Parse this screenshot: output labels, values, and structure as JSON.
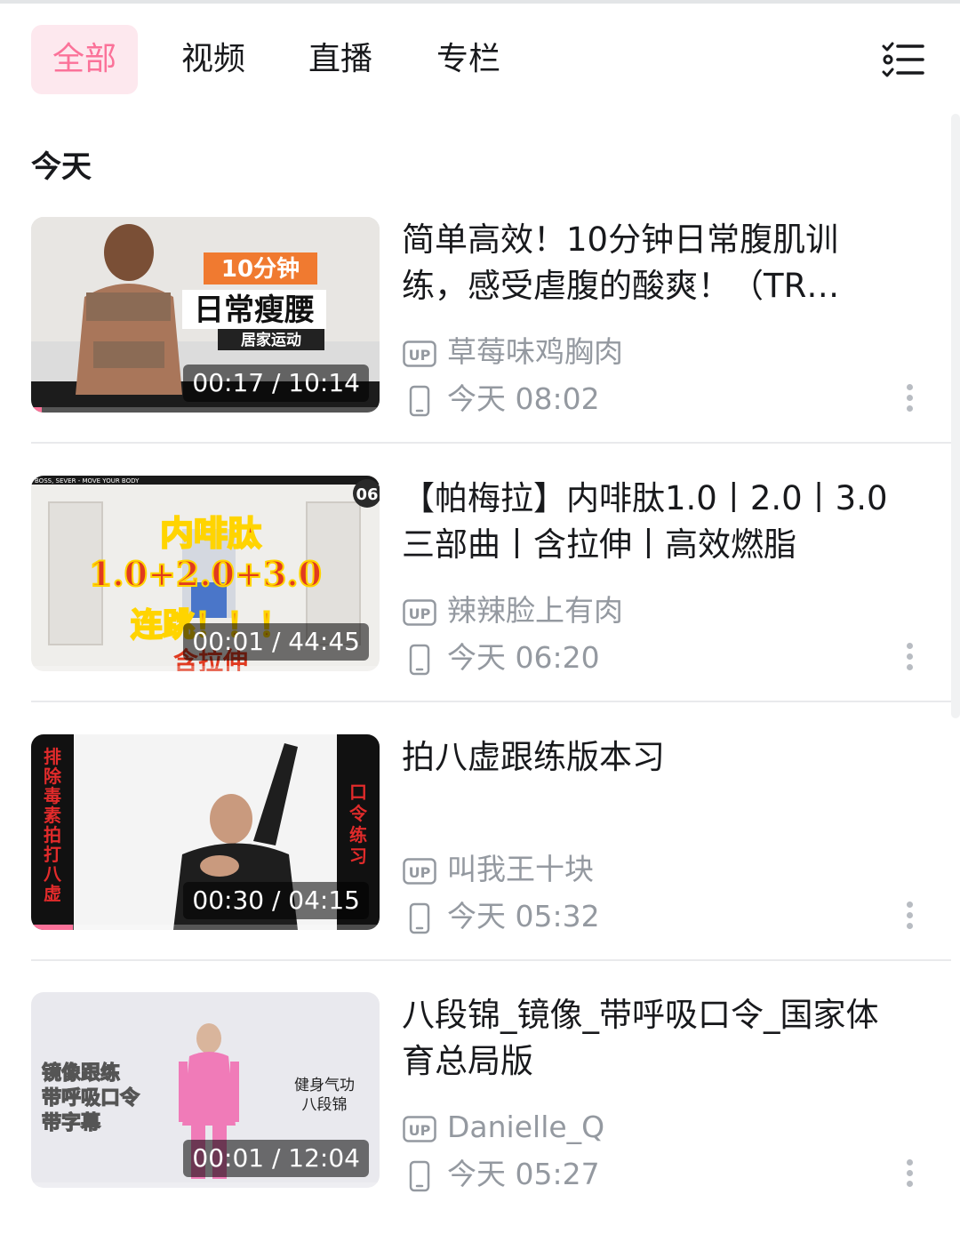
{
  "tabs": [
    {
      "label": "全部",
      "active": true
    },
    {
      "label": "视频",
      "active": false
    },
    {
      "label": "直播",
      "active": false
    },
    {
      "label": "专栏",
      "active": false
    }
  ],
  "menu_icon": "list-check-icon",
  "section_title": "今天",
  "colors": {
    "accent": "#fb7299",
    "tab_active_bg": "#fde8ee",
    "meta": "#9499a0"
  },
  "items": [
    {
      "title": "简单高效！10分钟日常腹肌训练，感受虐腹的酸爽！（TR…",
      "up_name": "草莓味鸡胸肉",
      "time": "今天 08:02",
      "duration": "00:17 / 10:14",
      "progress": 0.03,
      "thumb": {
        "line1": "10分钟",
        "line2": "日常瘦腰",
        "line3": "居家运动"
      }
    },
    {
      "title": "【帕梅拉】内啡肽1.0丨2.0丨3.0三部曲丨含拉伸丨高效燃脂",
      "up_name": "辣辣脸上有肉",
      "time": "今天 06:20",
      "duration": "00:01 / 44:45",
      "progress": 0.0,
      "thumb": {
        "line1": "内啡肽",
        "line2": "1.0+2.0+3.0",
        "line3": "连跳！！！",
        "line4": "含拉伸",
        "top_text": "BOSS, SEVER - MOVE YOUR BODY",
        "corner": "06"
      }
    },
    {
      "title": "拍八虚跟练版本习",
      "up_name": "叫我王十块",
      "time": "今天 05:32",
      "duration": "00:30 / 04:15",
      "progress": 0.12,
      "thumb": {
        "left_text": "排除毒素 拍打八虚",
        "right_text": "口令练习"
      }
    },
    {
      "title": "八段锦_镜像_带呼吸口令_国家体育总局版",
      "up_name": "Danielle_Q",
      "time": "今天 05:27",
      "duration": "00:01 / 12:04",
      "progress": 0.0,
      "thumb": {
        "left_line1": "镜像跟练",
        "left_line2": "带呼吸口令",
        "left_line3": "带字幕",
        "right_line1": "健身气功",
        "right_line2": "八段锦"
      }
    }
  ]
}
